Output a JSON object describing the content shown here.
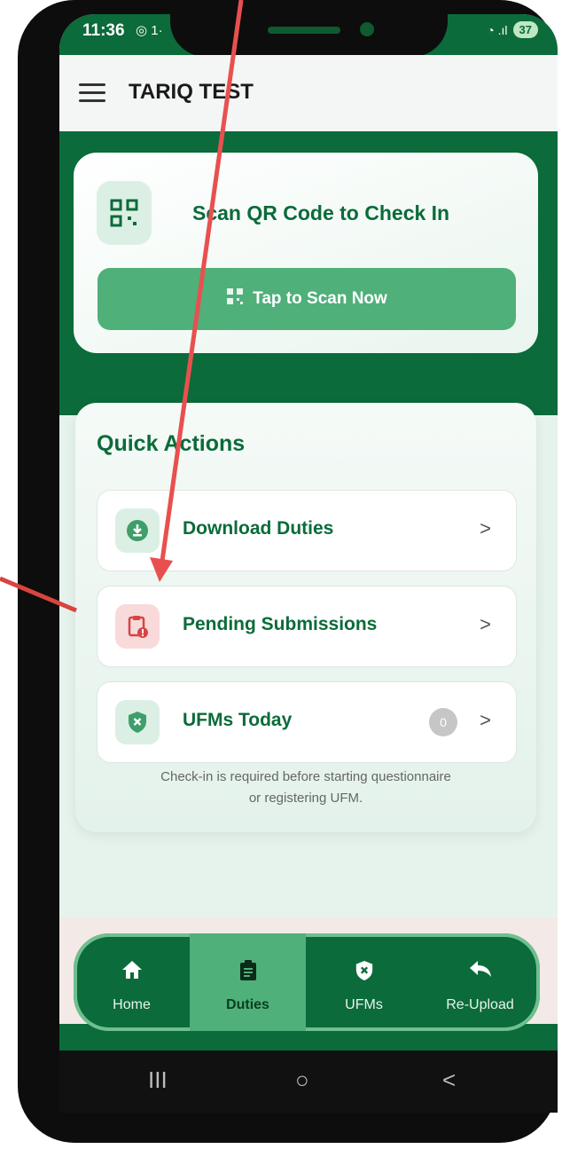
{
  "status_bar": {
    "time": "11:36",
    "notification_text": "◎ 1·",
    "signal_text": "◔ .ıl",
    "battery": "37"
  },
  "app_bar": {
    "title": "TARIQ TEST"
  },
  "scan_card": {
    "title": "Scan QR Code to Check In",
    "button_label": "Tap to Scan Now"
  },
  "quick_actions": {
    "title": "Quick Actions",
    "items": [
      {
        "label": "Download Duties",
        "icon": "download-icon"
      },
      {
        "label": "Pending Submissions",
        "icon": "clipboard-alert-icon"
      },
      {
        "label": "UFMs Today",
        "icon": "shield-x-icon",
        "count": "0"
      }
    ],
    "note_line1": "Check-in is required before starting questionnaire",
    "note_line2": "or registering UFM."
  },
  "tabs": [
    {
      "label": "Home",
      "icon": "home-icon"
    },
    {
      "label": "Duties",
      "icon": "clipboard-icon",
      "active": true
    },
    {
      "label": "UFMs",
      "icon": "shield-x-icon"
    },
    {
      "label": "Re-Upload",
      "icon": "reply-icon"
    }
  ],
  "system_nav": {
    "recents": "III",
    "home": "○",
    "back": "<"
  },
  "colors": {
    "primary": "#0b6b3a",
    "accent": "#4fb07a",
    "annotation": "#e8504f"
  }
}
